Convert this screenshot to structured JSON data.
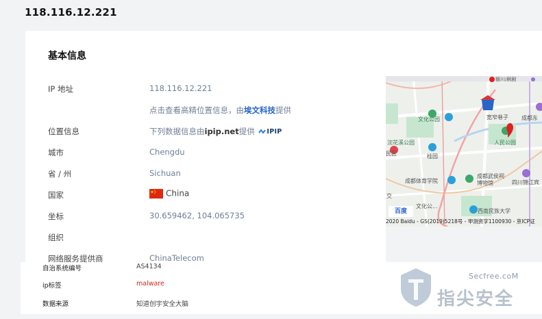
{
  "header": {
    "ip": "118.116.12.221"
  },
  "card": {
    "title": "基本信息",
    "rows": [
      {
        "label": "IP 地址",
        "value": "118.116.12.221"
      },
      {
        "label": "",
        "value_prefix": "点击查看高精位置信息，由",
        "value_link": "埃文科技",
        "value_suffix": "提供"
      },
      {
        "label": "位置信息",
        "value_prefix": "下列数据信息由",
        "value_link": "ipip.net",
        "value_suffix": "提供",
        "logo_text": "IPIP"
      },
      {
        "label": "城市",
        "value": "Chengdu"
      },
      {
        "label": "省 / 州",
        "value": "Sichuan"
      },
      {
        "label": "国家",
        "value": "China"
      },
      {
        "label": "坐标",
        "value": "30.659462, 104.065735"
      },
      {
        "label": "组织",
        "value": ""
      },
      {
        "label": "网络服务提供商",
        "value": "ChinaTelecom"
      }
    ]
  },
  "map": {
    "labels": [
      "宽窄巷子",
      "文化公园",
      "浣花溪公园",
      "人民公园",
      "成都东",
      "民区",
      "桂园",
      "成都体育学院",
      "成都武侯祠博物馆",
      "四川锦江宾",
      "西南民族大学",
      "交",
      "文化公...",
      "银川/刷剧"
    ],
    "caption": "2020 Baidu - GS(2019)5218号 - 甲测资字1100930 - 京ICP证",
    "logo": "百度"
  },
  "bottom": {
    "rows": [
      {
        "label": "自治系统编号",
        "value": "AS4134"
      },
      {
        "label": "ip标签",
        "value": "malware"
      },
      {
        "label": "数据来源",
        "value": "知道创宇安全大脑"
      }
    ]
  },
  "watermark": {
    "site": "Secfree.coM",
    "brand": "指尖安全"
  },
  "colors": {
    "accent": "#2462c9",
    "value_gray": "#6f7f95",
    "tag_red": "#d8251e",
    "pin_red": "#e02020"
  }
}
